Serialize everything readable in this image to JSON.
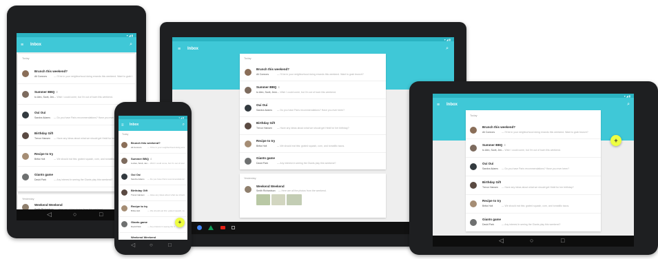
{
  "app": {
    "title": "Inbox",
    "menu_icon": "menu-icon",
    "search_icon": "search-icon",
    "status_indicators": "▾◢▮",
    "accent": "#3fc8d7",
    "fab_color": "#eeff41",
    "fab_label": "+"
  },
  "sections": {
    "today": "Today",
    "yesterday": "Yesterday"
  },
  "emails": [
    {
      "subject": "Brunch this weekend?",
      "sender": "Ali Connors",
      "snippet": "— I'll be in your neighborhood doing errands this weekend. Want to grab brunch?"
    },
    {
      "subject": "Summer BBQ",
      "badge": "4",
      "sender": "to Alex, Scott, Jennifer",
      "snippet": "— Wish I could come, but I'm out of town this weekend."
    },
    {
      "subject": "Oui Oui",
      "sender": "Sandra Adams",
      "snippet": "— Do you have Paris recommendations? Have you ever been?"
    },
    {
      "subject": "Birthday Gift",
      "sender": "Trevor Hansen",
      "snippet": "— Have any ideas about what we should get Heidi for her birthday?"
    },
    {
      "subject": "Recipe to try",
      "sender": "Britta Holt",
      "snippet": "— We should eat this: grated squash, corn, and tomatillo tacos."
    },
    {
      "subject": "Giants game",
      "sender": "David Park",
      "snippet": "— Any interest in seeing the Giants play this weekend?"
    }
  ],
  "yesterday_email": {
    "subject": "Weekend Weekend",
    "sender": "Smith Richardson",
    "snippet": "— Here are all the photos from the weekend."
  },
  "nav": {
    "back": "◁",
    "home": "○",
    "recents": "□"
  },
  "dock_icons": [
    "chrome-icon",
    "drive-icon",
    "youtube-icon",
    "apps-icon"
  ]
}
